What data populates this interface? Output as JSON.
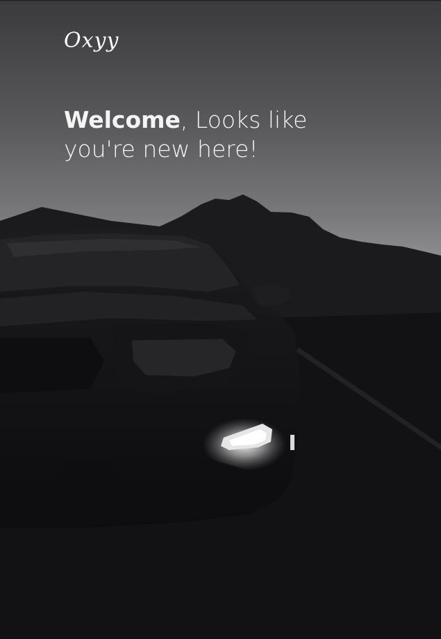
{
  "brand": {
    "logo_text": "Oxyy"
  },
  "hero": {
    "headline_strong": "Welcome",
    "headline_rest": ", Looks like you're new here!"
  },
  "colors": {
    "text": "#ffffff",
    "background_dark": "#111113"
  }
}
